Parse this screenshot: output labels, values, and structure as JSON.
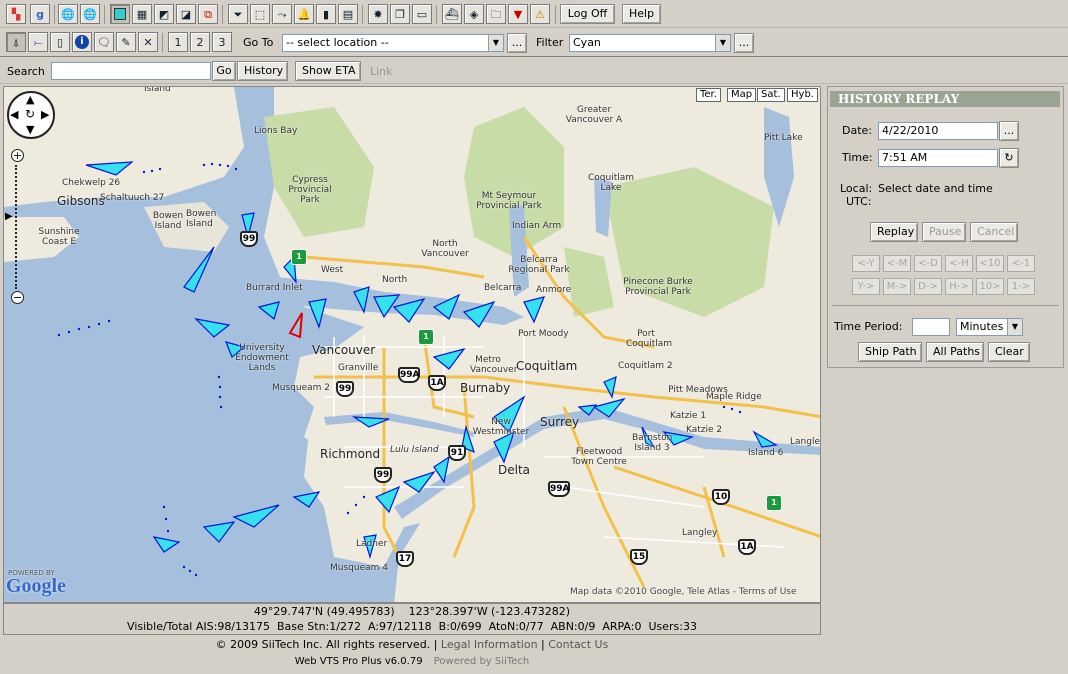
{
  "toolbar": {
    "logoff_label": "Log Off",
    "help_label": "Help",
    "goto_label": "Go To",
    "goto_value": "-- select location --",
    "filter_label": "Filter",
    "filter_value": "Cyan",
    "more_label": "...",
    "link_nums": [
      "1",
      "2",
      "3"
    ]
  },
  "search": {
    "label": "Search",
    "value": "",
    "go_label": "Go",
    "history_label": "History",
    "showeta_label": "Show ETA",
    "link_label": "Link"
  },
  "map": {
    "types": [
      "Ter.",
      "Map",
      "Sat.",
      "Hyb."
    ],
    "labels": [
      "Island",
      "Lions Bay",
      "Greater Vancouver A",
      "Pitt Lake",
      "Cypress Provincial Park",
      "Coquitlam Lake",
      "Mt Seymour Provincial Park",
      "Indian Arm",
      "Chekwelp 26",
      "Gibsons",
      "Schaltuuch 27",
      "Bowen Island",
      "Bowen Island",
      "Sunshine Coast E",
      "North Vancouver",
      "Belcarra Regional Park",
      "Pinecone Burke Provincial Park",
      "West",
      "North",
      "Burrard Inlet",
      "Belcarra",
      "Anmore",
      "Port Moody",
      "Port Coquitlam",
      "University Endowment Lands",
      "Vancouver",
      "Metro Vancouver",
      "Coquitlam",
      "Coquitlam 2",
      "Granville",
      "Burnaby",
      "Musqueam 2",
      "Pitt Meadows",
      "Maple Ridge",
      "Katzie 1",
      "Katzie 2",
      "Barnston Island 3",
      "Langley",
      "Island 6",
      "New Westminster",
      "Surrey",
      "Richmond",
      "Lulu Island",
      "Delta",
      "Fleetwood Town Centre",
      "Langley",
      "Ladner",
      "Musqueam 4"
    ],
    "shields": [
      "99",
      "1",
      "99",
      "1A",
      "99A",
      "1",
      "99",
      "91",
      "99A",
      "10",
      "1",
      "17",
      "15",
      "1A"
    ],
    "attribution": "Map data ©2010 Google, Tele Atlas - Terms of Use",
    "powered_by": "POWERED BY",
    "google": "Google"
  },
  "status": {
    "coords": "49°29.747'N (49.495783)    123°28.397'W (-123.473282)",
    "counts": "Visible/Total AIS:98/13175  Base Stn:1/272  A:97/12118  B:0/699  AtoN:0/77  ABN:0/9  ARPA:0  Users:33"
  },
  "footer": {
    "copyright": "© 2009 SiiTech Inc. All rights reserved.",
    "legal": "Legal Information",
    "contact": "Contact Us",
    "version": "Web VTS Pro Plus v6.0.79",
    "powered": "Powered by SiiTech"
  },
  "history": {
    "title": "HISTORY REPLAY",
    "date_label": "Date:",
    "date_value": "4/22/2010",
    "time_label": "Time:",
    "time_value": "7:51 AM",
    "local_label": "Local:",
    "local_value": "Select date and time",
    "utc_label": "UTC:",
    "replay": "Replay",
    "pause": "Pause",
    "cancel": "Cancel",
    "back_buttons": [
      "<-Y",
      "<-M",
      "<-D",
      "<-H",
      "<10",
      "<-1"
    ],
    "fwd_buttons": [
      "Y->",
      "M->",
      "D->",
      "H->",
      "10>",
      "1->"
    ],
    "period_label": "Time Period:",
    "period_value": "",
    "period_unit": "Minutes",
    "ship_path": "Ship Path",
    "all_paths": "All Paths",
    "clear": "Clear"
  },
  "colors": {
    "ship_fill": "#36e0ec",
    "ship_outline": "#0018d8",
    "ship_selected": "#e00000",
    "water": "#a5bfdd",
    "land": "#eeeade",
    "park": "#c8dca8"
  }
}
